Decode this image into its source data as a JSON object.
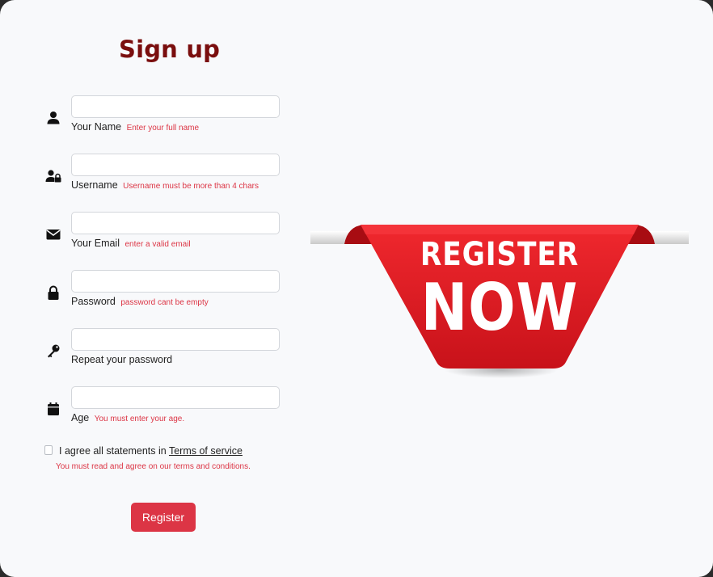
{
  "form": {
    "title": "Sign up",
    "fields": [
      {
        "icon": "user-icon",
        "label": "Your Name",
        "error": "Enter your full name",
        "value": ""
      },
      {
        "icon": "user-lock-icon",
        "label": "Username",
        "error": "Username must be more than 4 chars",
        "value": ""
      },
      {
        "icon": "envelope-icon",
        "label": "Your Email",
        "error": "enter a valid email",
        "value": ""
      },
      {
        "icon": "lock-icon",
        "label": "Password",
        "error": "password cant be empty",
        "value": ""
      },
      {
        "icon": "key-icon",
        "label": "Repeat your password",
        "error": "",
        "value": ""
      },
      {
        "icon": "calendar-icon",
        "label": "Age",
        "error": "You must enter your age.",
        "value": ""
      }
    ],
    "agree": {
      "text": "I agree all statements in",
      "link": "Terms of service",
      "checked": false,
      "error": "You must read and agree on our terms and conditions."
    },
    "register_label": "Register"
  },
  "banner": {
    "line1": "REGISTER",
    "line2": "NOW"
  },
  "colors": {
    "title": "#7a0e0e",
    "error": "#dc3545",
    "button": "#dc3545",
    "banner_red": "#e8202a",
    "background": "#f8f9fb"
  }
}
